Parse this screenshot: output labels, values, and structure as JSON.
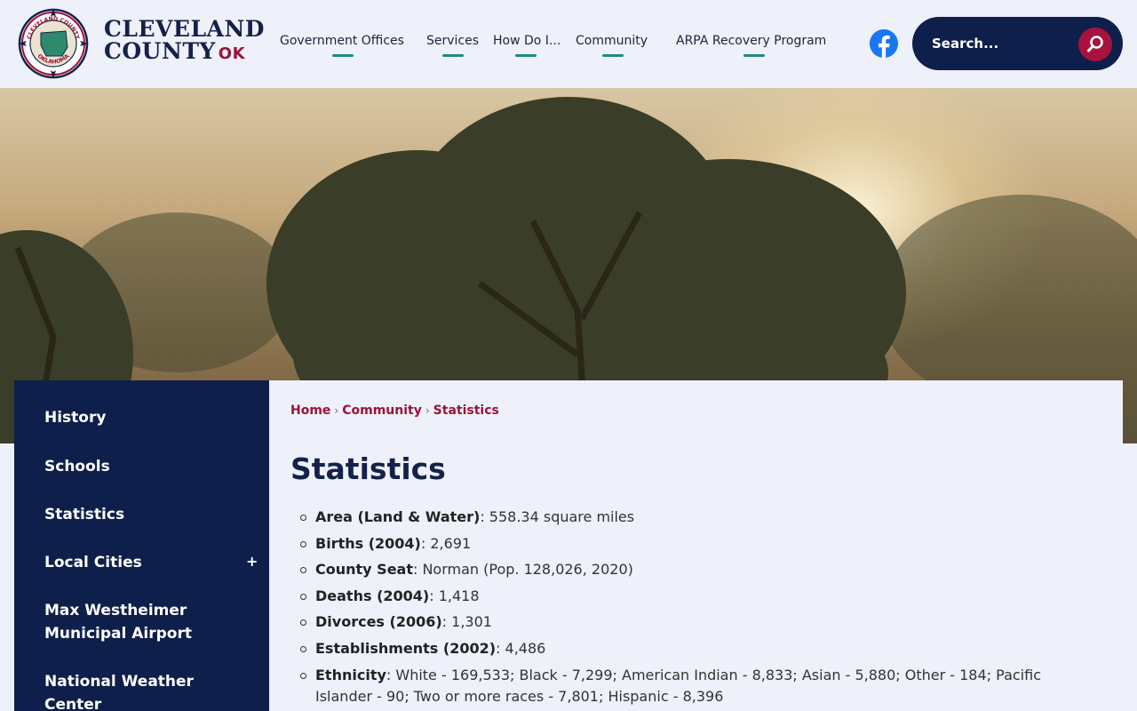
{
  "brand": {
    "line1": "CLEVELAND",
    "line2": "COUNTY",
    "ok": "OK",
    "seal_top": "CLEVELAND COUNTY",
    "seal_bottom": "OKLAHOMA"
  },
  "nav": [
    {
      "label": "Government Offices"
    },
    {
      "label": "Services"
    },
    {
      "label": "How Do I..."
    },
    {
      "label": "Community"
    },
    {
      "label": "ARPA Recovery Program"
    }
  ],
  "search": {
    "placeholder": "Search..."
  },
  "sidebar": {
    "items": [
      {
        "label": "History"
      },
      {
        "label": "Schools"
      },
      {
        "label": "Statistics"
      },
      {
        "label": "Local Cities",
        "expand": "+"
      },
      {
        "label": "Max Westheimer Municipal Airport"
      },
      {
        "label": "National Weather Center"
      }
    ]
  },
  "breadcrumb": {
    "home": "Home",
    "community": "Community",
    "current": "Statistics",
    "sep": "›"
  },
  "page": {
    "title": "Statistics"
  },
  "stats": [
    {
      "label": "Area (Land & Water)",
      "value": ": 558.34 square miles"
    },
    {
      "label": "Births (2004)",
      "value": ": 2,691"
    },
    {
      "label": "County Seat",
      "value": ": Norman (Pop. 128,026, 2020)"
    },
    {
      "label": "Deaths (2004)",
      "value": ": 1,418"
    },
    {
      "label": "Divorces (2006)",
      "value": ": 1,301"
    },
    {
      "label": "Establishments (2002)",
      "value": ": 4,486"
    },
    {
      "label": "Ethnicity",
      "value": ": White - 169,533; Black - 7,299; American Indian - 8,833; Asian - 5,880; Other - 184; Pacific Islander - 90; Two or more races - 7,801; Hispanic - 8,396"
    }
  ],
  "colors": {
    "navy": "#0e1f4b",
    "accent": "#1f8a84",
    "crimson": "#9c1237",
    "background": "#eef0fa",
    "facebook": "#1877f2"
  },
  "icons": {
    "facebook": "facebook-icon",
    "search": "search-icon",
    "expand": "plus-icon"
  }
}
